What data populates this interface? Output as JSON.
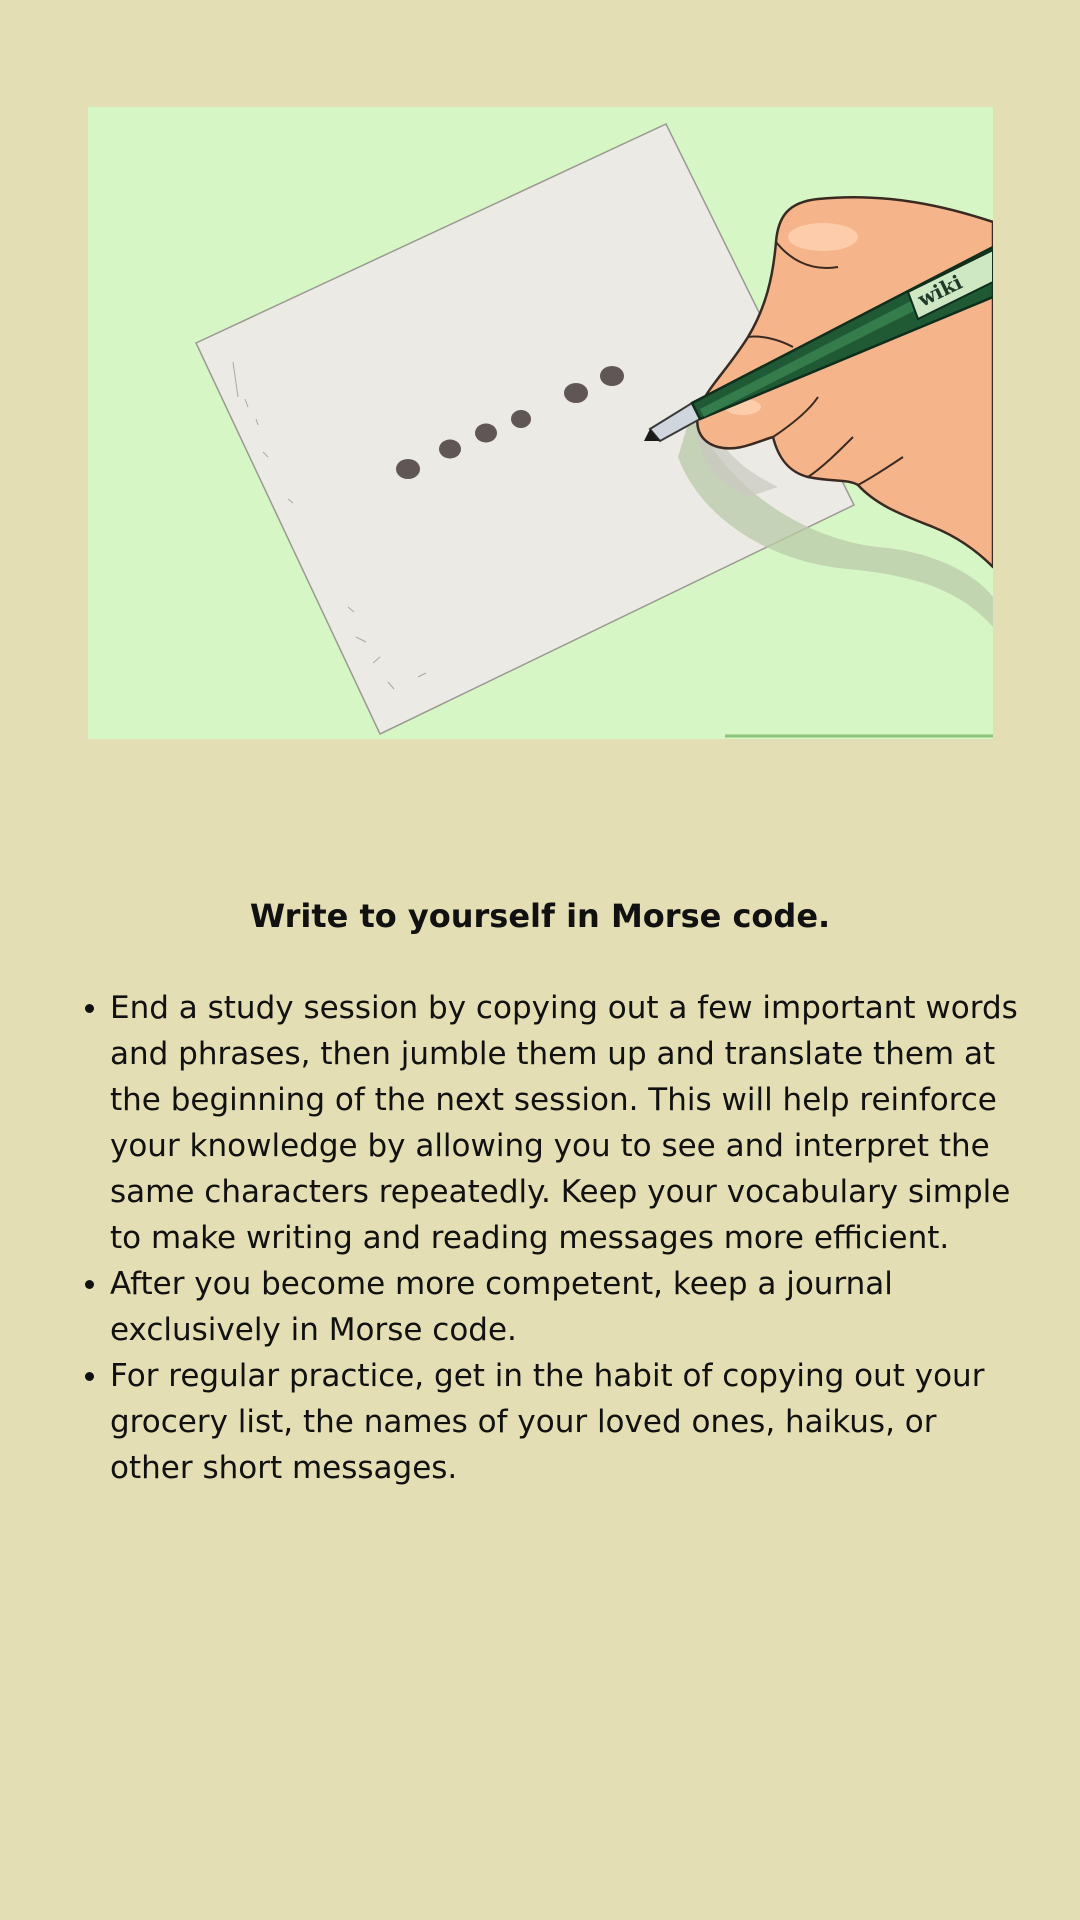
{
  "article": {
    "illustration": {
      "watermark": "wiki",
      "colors": {
        "background": "#d7f6c5",
        "paper": "#eceae4",
        "dots": "#605656",
        "pen": "#1f5a34",
        "skin": "#f6b48a"
      }
    },
    "step_title": "Write to yourself in Morse code.",
    "tips": [
      "End a study session by copying out a few important words and phrases, then jumble them up and translate them at the beginning of the next session. This will help reinforce your knowledge by allowing you to see and interpret the same characters repeatedly. Keep your vocabulary simple to make writing and reading messages more efficient.",
      "After you become more competent, keep a journal exclusively in Morse code.",
      "For regular practice, get in the habit of copying out your grocery list, the names of your loved ones, haikus, or other short messages."
    ]
  }
}
